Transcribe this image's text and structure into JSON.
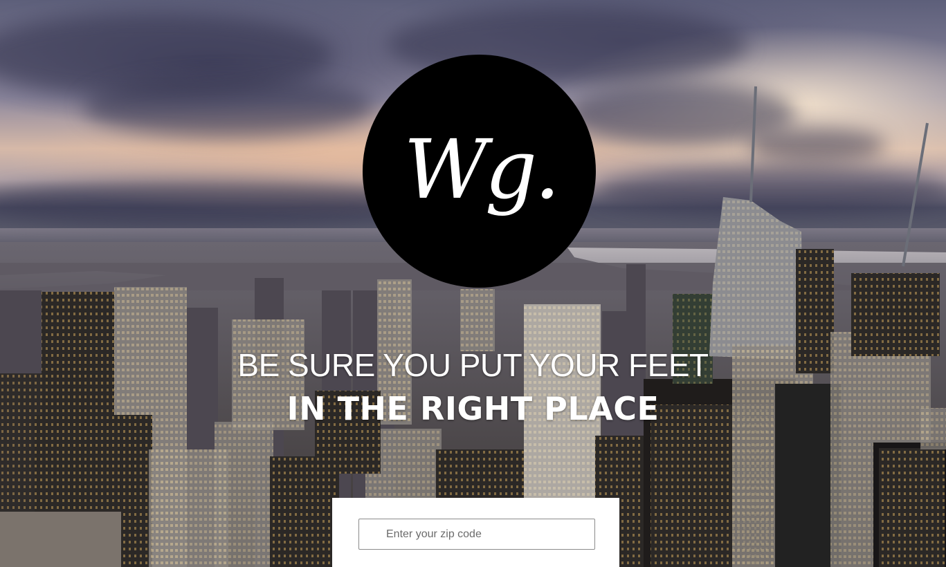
{
  "logo": {
    "text": "Wg."
  },
  "hero": {
    "tagline_line1": "BE SURE YOU PUT YOUR FEET",
    "tagline_line2": "IN THE RIGHT PLACE"
  },
  "search": {
    "zip_placeholder": "Enter your zip code"
  },
  "colors": {
    "logo_background": "#000000",
    "logo_text": "#ffffff",
    "tagline_text": "#ffffff",
    "panel_background": "#ffffff",
    "input_border": "#8a8a8a",
    "placeholder_text": "#6b6b6b"
  }
}
